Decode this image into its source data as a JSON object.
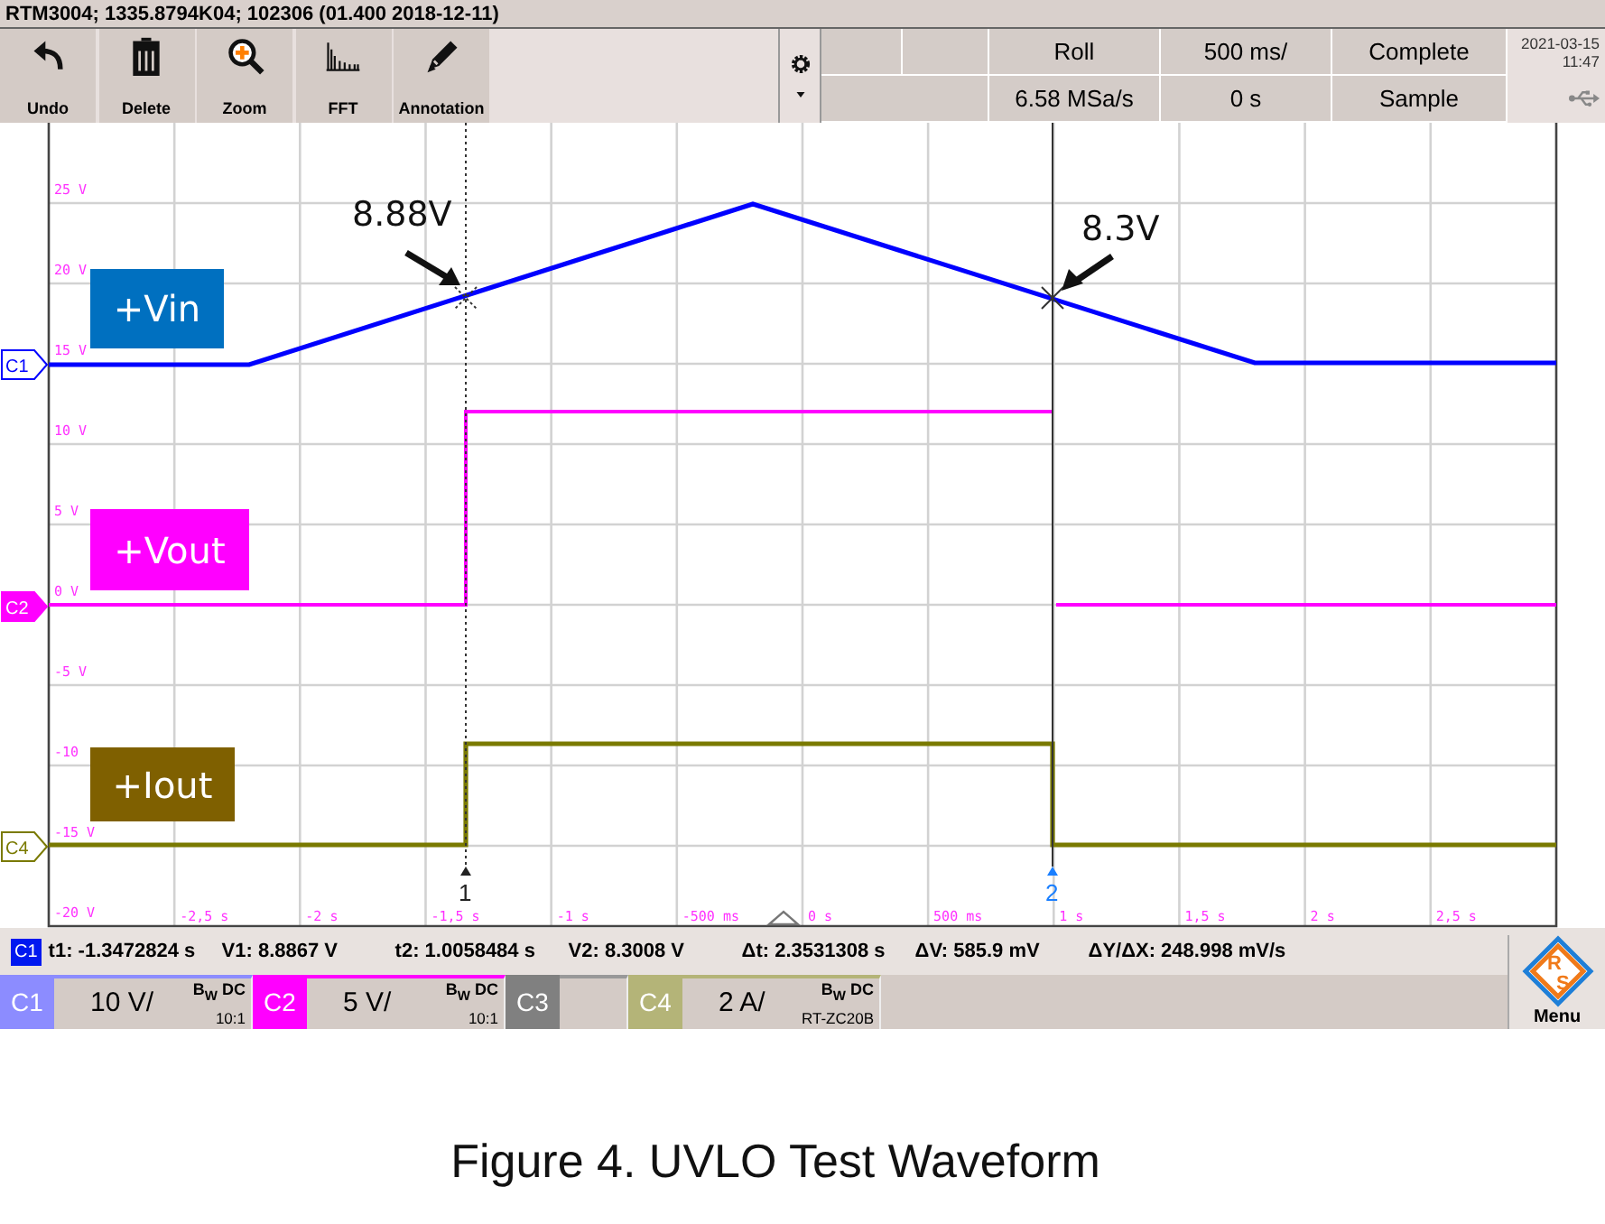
{
  "title_bar": "RTM3004; 1335.8794K04; 102306 (01.400 2018-12-11)",
  "toolbar": [
    {
      "kind": "undo",
      "label": "Undo"
    },
    {
      "kind": "delete",
      "label": "Delete"
    },
    {
      "kind": "zoom",
      "label": "Zoom"
    },
    {
      "kind": "fft",
      "label": "FFT"
    },
    {
      "kind": "annotation",
      "label": "Annotation"
    }
  ],
  "acquisition": {
    "row_1": [
      "Roll",
      "500 ms/",
      "Complete"
    ],
    "row_2": [
      "6.58 MSa/s",
      "0 s",
      "Sample"
    ]
  },
  "date": "2021-03-15",
  "time": "11:47",
  "plot": {
    "volt_labels": [
      "25 V",
      "20 V",
      "15 V",
      "10 V",
      "5 V",
      "0 V",
      "-5 V",
      "-10",
      "-15 V",
      "-20 V"
    ],
    "time_labels": [
      "-2,5 s",
      "-2 s",
      "-1,5 s",
      "-1 s",
      "-500 ms",
      "0 s",
      "500 ms",
      "1 s",
      "1,5 s",
      "2 s",
      "2,5 s"
    ],
    "traces": [
      {
        "marker": "C1",
        "color": "#0000ff",
        "selected": false
      },
      {
        "marker": "C2",
        "color": "#ff00ff",
        "selected": true
      },
      {
        "marker": "C4",
        "color": "#7a7a00",
        "selected": false
      }
    ],
    "trace_labels": [
      {
        "text": "+Vin",
        "color": "#0070c0"
      },
      {
        "text": "+Vout",
        "color": "#ff00ff"
      },
      {
        "text": "+Iout",
        "color": "#7f6000"
      }
    ],
    "annotations": [
      "8.88V",
      "8.3V"
    ],
    "cursors": [
      "1",
      "2"
    ]
  },
  "measurement": {
    "source": "C1",
    "items": [
      "t1: -1.3472824 s",
      "V1: 8.8867 V",
      "t2: 1.0058484 s",
      "V2: 8.3008 V",
      "Δt: 2.3531308 s",
      "ΔV: 585.9 mV",
      "ΔY/ΔX: 248.998 mV/s"
    ]
  },
  "channels": [
    {
      "name": "C1",
      "color": "#8c8cff",
      "scale": "10 V/",
      "coupling": "B$_{W}$ DC",
      "probe": "10:1"
    },
    {
      "name": "C2",
      "color": "#ff00ff",
      "scale": "5 V/",
      "coupling": "B$_{W}$ DC",
      "probe": "10:1"
    },
    {
      "name": "C3",
      "color": "#808080"
    },
    {
      "name": "C4",
      "color": "#b4b478",
      "scale": "2 A/",
      "coupling": "B$_{W}$ DC",
      "probe": "RT-ZC20B"
    }
  ],
  "menu": {
    "logo_letters": [
      "R",
      "S"
    ],
    "label": "Menu"
  },
  "caption": "Figure 4. UVLO Test Waveform"
}
